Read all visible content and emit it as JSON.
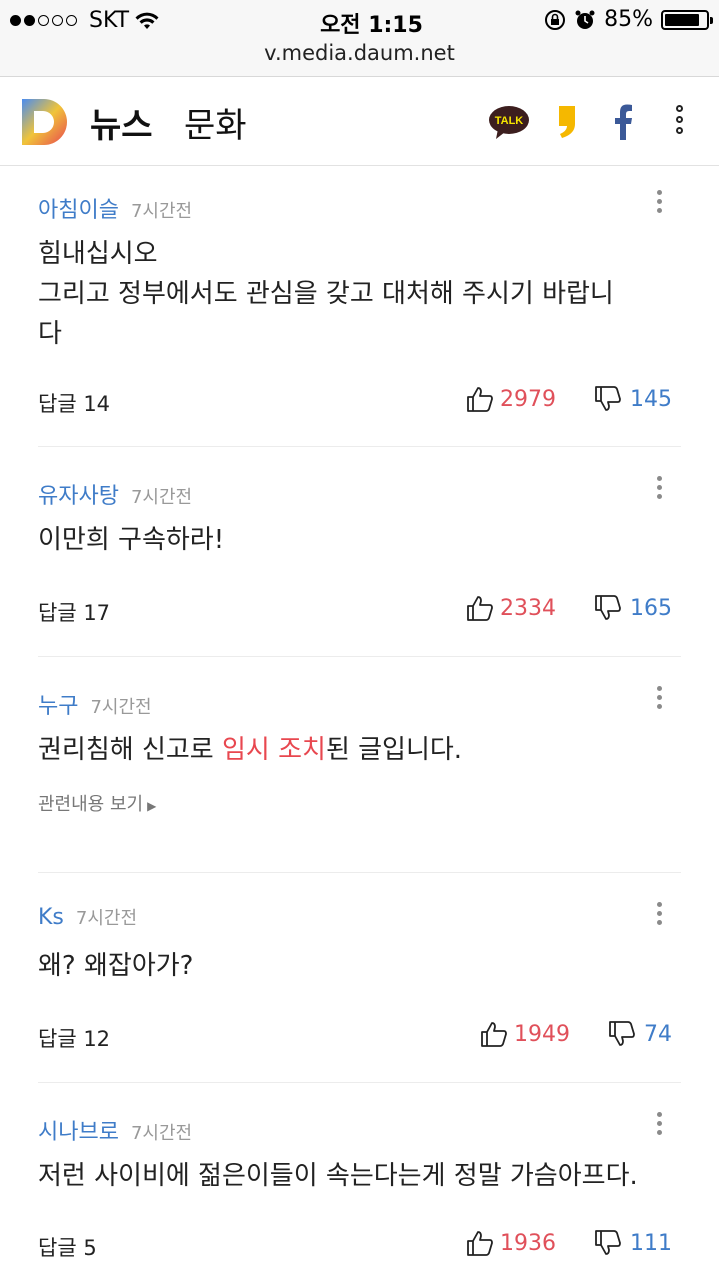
{
  "status_bar": {
    "carrier": "SKT",
    "time": "오전 1:15",
    "battery": "85%",
    "battery_level": 0.85
  },
  "browser": {
    "url": "v.media.daum.net"
  },
  "header": {
    "news_label": "뉴스",
    "category_label": "문화",
    "kakao_label": "TALK"
  },
  "comments": [
    {
      "author": "아침이슬",
      "time": "7시간전",
      "lines": [
        "힘내십시오",
        "그리고 정부에서도  관심을 갖고 대처해 주시기 바랍니",
        "다"
      ],
      "reply": "답글 14",
      "likes": "2979",
      "dislikes": "145"
    },
    {
      "author": "유자사탕",
      "time": "7시간전",
      "lines": [
        "이만희 구속하라!"
      ],
      "reply": "답글 17",
      "likes": "2334",
      "dislikes": "165"
    },
    {
      "author": "누구",
      "time": "7시간전",
      "notice_pre": "권리침해 신고로 ",
      "notice_highlight": "임시 조치",
      "notice_post": "된 글입니다.",
      "related": "관련내용 보기"
    },
    {
      "author": "Ks",
      "time": "7시간전",
      "lines": [
        "왜? 왜잡아가?"
      ],
      "reply": "답글 12",
      "likes": "1949",
      "dislikes": "74"
    },
    {
      "author": "시나브로",
      "time": "7시간전",
      "lines": [
        "저런 사이비에 젊은이들이 속는다는게 정말 가슴아프다."
      ],
      "reply": "답글 5",
      "likes": "1936",
      "dislikes": "111"
    }
  ],
  "colors": {
    "author": "#3f7cc8",
    "like": "#e0505a",
    "dislike": "#3f7cc8",
    "highlight": "#e8474f"
  }
}
